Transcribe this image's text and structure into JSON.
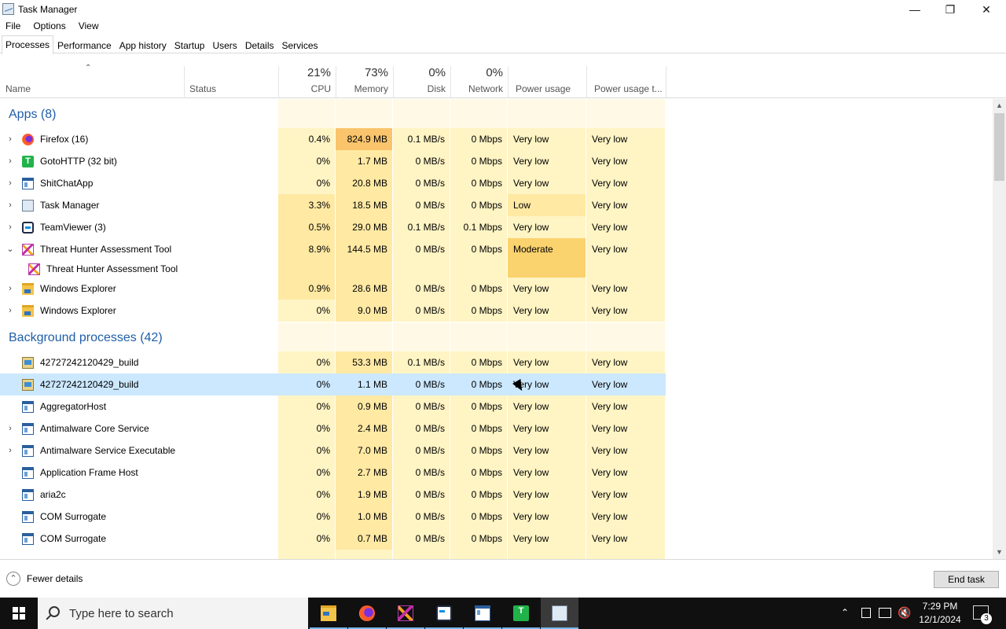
{
  "window": {
    "title": "Task Manager"
  },
  "menu": [
    "File",
    "Options",
    "View"
  ],
  "tabs": [
    "Processes",
    "Performance",
    "App history",
    "Startup",
    "Users",
    "Details",
    "Services"
  ],
  "columns": {
    "name": "Name",
    "status": "Status",
    "cpu": {
      "pct": "21%",
      "label": "CPU"
    },
    "memory": {
      "pct": "73%",
      "label": "Memory"
    },
    "disk": {
      "pct": "0%",
      "label": "Disk"
    },
    "network": {
      "pct": "0%",
      "label": "Network"
    },
    "power": "Power usage",
    "power_trend": "Power usage t..."
  },
  "groups": {
    "apps": "Apps (8)",
    "background": "Background processes (42)"
  },
  "apps": [
    {
      "name": "Firefox (16)",
      "icon": "firefox-icon",
      "expander": "›",
      "cpu": "0.4%",
      "memory": "824.9 MB",
      "disk": "0.1 MB/s",
      "network": "0 Mbps",
      "power": "Very low",
      "power_trend": "Very low"
    },
    {
      "name": "GotoHTTP (32 bit)",
      "icon": "gotohttp-icon",
      "expander": "›",
      "cpu": "0%",
      "memory": "1.7 MB",
      "disk": "0 MB/s",
      "network": "0 Mbps",
      "power": "Very low",
      "power_trend": "Very low"
    },
    {
      "name": "ShitChatApp",
      "icon": "app-window-icon",
      "expander": "›",
      "cpu": "0%",
      "memory": "20.8 MB",
      "disk": "0 MB/s",
      "network": "0 Mbps",
      "power": "Very low",
      "power_trend": "Very low"
    },
    {
      "name": "Task Manager",
      "icon": "task-manager-icon",
      "expander": "›",
      "cpu": "3.3%",
      "memory": "18.5 MB",
      "disk": "0 MB/s",
      "network": "0 Mbps",
      "power": "Low",
      "power_trend": "Very low"
    },
    {
      "name": "TeamViewer (3)",
      "icon": "teamviewer-icon",
      "expander": "›",
      "cpu": "0.5%",
      "memory": "29.0 MB",
      "disk": "0.1 MB/s",
      "network": "0.1 Mbps",
      "power": "Very low",
      "power_trend": "Very low"
    },
    {
      "name": "Threat Hunter Assessment Tool",
      "icon": "threat-hunter-icon",
      "expander": "⌄",
      "cpu": "8.9%",
      "memory": "144.5 MB",
      "disk": "0 MB/s",
      "network": "0 Mbps",
      "power": "Moderate",
      "power_trend": "Very low"
    },
    {
      "name": "Threat Hunter Assessment Tool",
      "icon": "threat-hunter-icon",
      "expander": "",
      "child": true,
      "cpu": "",
      "memory": "",
      "disk": "",
      "network": "",
      "power": "",
      "power_trend": ""
    },
    {
      "name": "Windows Explorer",
      "icon": "folder-icon",
      "expander": "›",
      "cpu": "0.9%",
      "memory": "28.6 MB",
      "disk": "0 MB/s",
      "network": "0 Mbps",
      "power": "Very low",
      "power_trend": "Very low"
    },
    {
      "name": "Windows Explorer",
      "icon": "folder-icon",
      "expander": "›",
      "cpu": "0%",
      "memory": "9.0 MB",
      "disk": "0 MB/s",
      "network": "0 Mbps",
      "power": "Very low",
      "power_trend": "Very low"
    }
  ],
  "background": [
    {
      "name": "42727242120429_build",
      "icon": "build-icon",
      "expander": "",
      "cpu": "0%",
      "memory": "53.3 MB",
      "disk": "0.1 MB/s",
      "network": "0 Mbps",
      "power": "Very low",
      "power_trend": "Very low"
    },
    {
      "name": "42727242120429_build",
      "icon": "build-icon",
      "expander": "",
      "selected": true,
      "cpu": "0%",
      "memory": "1.1 MB",
      "disk": "0 MB/s",
      "network": "0 Mbps",
      "power": "Very low",
      "power_trend": "Very low"
    },
    {
      "name": "AggregatorHost",
      "icon": "app-window-icon",
      "expander": "",
      "cpu": "0%",
      "memory": "0.9 MB",
      "disk": "0 MB/s",
      "network": "0 Mbps",
      "power": "Very low",
      "power_trend": "Very low"
    },
    {
      "name": "Antimalware Core Service",
      "icon": "app-window-icon",
      "expander": "›",
      "cpu": "0%",
      "memory": "2.4 MB",
      "disk": "0 MB/s",
      "network": "0 Mbps",
      "power": "Very low",
      "power_trend": "Very low"
    },
    {
      "name": "Antimalware Service Executable",
      "icon": "app-window-icon",
      "expander": "›",
      "cpu": "0%",
      "memory": "7.0 MB",
      "disk": "0 MB/s",
      "network": "0 Mbps",
      "power": "Very low",
      "power_trend": "Very low"
    },
    {
      "name": "Application Frame Host",
      "icon": "app-window-icon",
      "expander": "",
      "cpu": "0%",
      "memory": "2.7 MB",
      "disk": "0 MB/s",
      "network": "0 Mbps",
      "power": "Very low",
      "power_trend": "Very low"
    },
    {
      "name": "aria2c",
      "icon": "app-window-icon",
      "expander": "",
      "cpu": "0%",
      "memory": "1.9 MB",
      "disk": "0 MB/s",
      "network": "0 Mbps",
      "power": "Very low",
      "power_trend": "Very low"
    },
    {
      "name": "COM Surrogate",
      "icon": "app-window-icon",
      "expander": "",
      "cpu": "0%",
      "memory": "1.0 MB",
      "disk": "0 MB/s",
      "network": "0 Mbps",
      "power": "Very low",
      "power_trend": "Very low"
    },
    {
      "name": "COM Surrogate",
      "icon": "app-window-icon",
      "expander": "",
      "cpu": "0%",
      "memory": "0.7 MB",
      "disk": "0 MB/s",
      "network": "0 Mbps",
      "power": "Very low",
      "power_trend": "Very low"
    }
  ],
  "footer": {
    "fewer_details": "Fewer details",
    "end_task": "End task"
  },
  "taskbar": {
    "search_placeholder": "Type here to search",
    "time": "7:29 PM",
    "date": "12/1/2024",
    "notification_count": "3",
    "apps": [
      "file-explorer-icon",
      "firefox-icon",
      "threat-hunter-icon",
      "teamviewer-icon",
      "app-window-icon",
      "gotohttp-icon",
      "task-manager-icon"
    ]
  },
  "colors": {
    "heat_light": "#fff4c4",
    "heat_mid": "#ffe9a3",
    "heat_high": "#f9c46c",
    "heat_moderate": "#fad26e",
    "selected_row": "#cce8ff",
    "group_title": "#1f5ea8",
    "header_cols_bg": "#fff9e6"
  }
}
